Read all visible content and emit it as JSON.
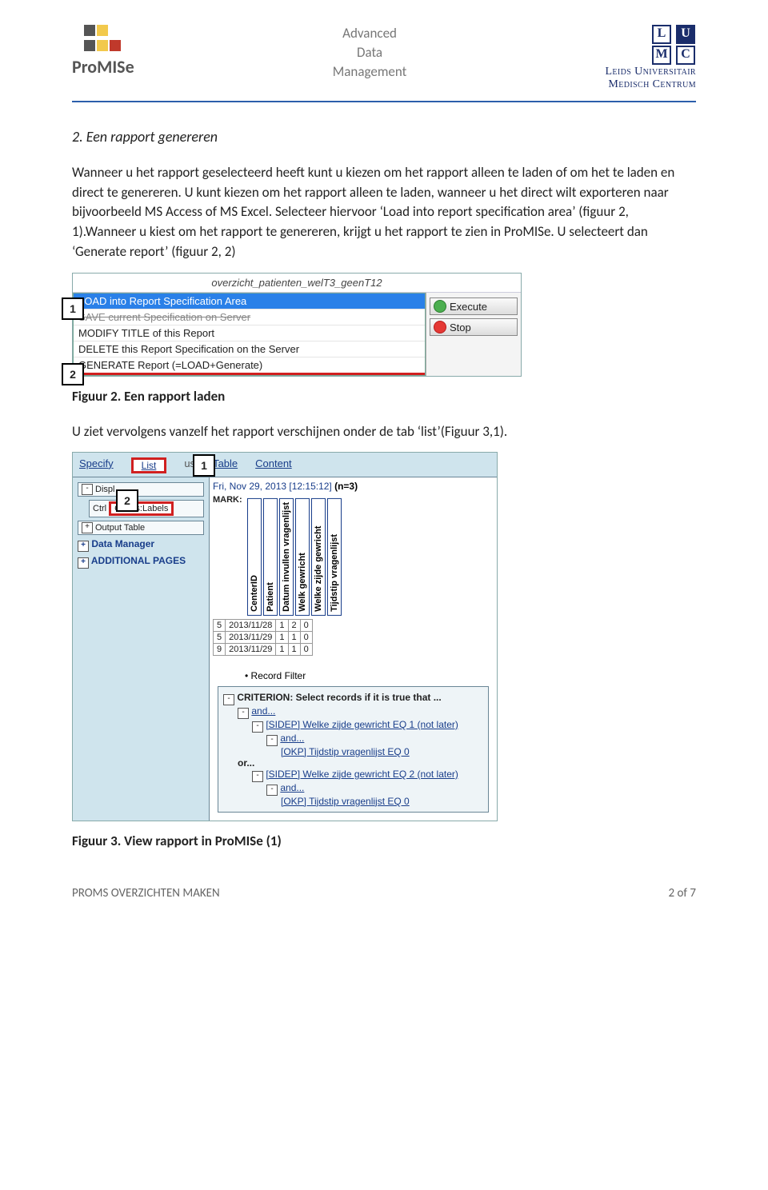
{
  "header": {
    "promise_word": "ProMISe",
    "center_l1": "Advanced",
    "center_l2": "Data",
    "center_l3": "Management",
    "lumc_l": "L",
    "lumc_u": "U",
    "lumc_m": "M",
    "lumc_c": "C",
    "lumc_txt1": "Leids Universitair",
    "lumc_txt2": "Medisch Centrum"
  },
  "section": {
    "num": "2.",
    "title": "Een rapport genereren"
  },
  "para1": "Wanneer u het rapport geselecteerd heeft kunt u kiezen om het rapport alleen te laden of om het te laden en direct te genereren. U kunt kiezen om het rapport alleen te laden, wanneer u het direct wilt exporteren naar bijvoorbeeld MS Access of MS Excel. Selecteer hiervoor ‘Load into report specification area’ (figuur 2, 1).Wanneer u kiest om het rapport te genereren, krijgt u het rapport te zien in ProMISe. U selecteert dan ‘Generate report’ (figuur 2, 2)",
  "fig2": {
    "report_name": "overzicht_patienten_welT3_geenT12",
    "opt1": "LOAD into Report Specification Area",
    "opt2": "SAVE current Specification on Server",
    "opt3": "MODIFY TITLE of this Report",
    "opt4": "DELETE this Report Specification on the Server",
    "opt5": "GENERATE Report (=LOAD+Generate)",
    "btn_exec": "Execute",
    "btn_stop": "Stop",
    "callout1": "1",
    "callout2": "2",
    "caption": "Figuur 2. Een rapport laden"
  },
  "para2": "U ziet vervolgens vanzelf het rapport verschijnen onder de tab ‘list’(Figuur 3,1).",
  "fig3": {
    "tabs": {
      "specify": "Specify",
      "list": "List",
      "us": "us",
      "table": "Table",
      "content": "Content"
    },
    "callout1": "1",
    "callout2": "2",
    "left": {
      "displ": "Displ",
      "ctrl": "Ctrl",
      "codes": "Codes:Labels",
      "output": "Output Table",
      "datamgr": "Data Manager",
      "addpages": "ADDITIONAL PAGES"
    },
    "date": "Fri, Nov 29, 2013 [12:15:12] ",
    "n": "(n=3)",
    "mark": "MARK:",
    "cols": [
      "CenterID",
      "Patient",
      "Datum invullen vragenlijst",
      "Welk gewricht",
      "Welke zijde gewricht",
      "Tijdstip vragenlijst"
    ],
    "rows": [
      [
        "5",
        "2013/11/28",
        "1",
        "2",
        "0"
      ],
      [
        "5",
        "2013/11/29",
        "1",
        "1",
        "0"
      ],
      [
        "9",
        "2013/11/29",
        "1",
        "1",
        "0"
      ]
    ],
    "record_filter": "Record Filter",
    "crit_header": "CRITERION: Select records if it is true that ...",
    "and": "and...",
    "line1": "[SIDEP] Welke zijde gewricht EQ 1 (not later)",
    "line_okp": "[OKP] Tijdstip vragenlijst EQ 0",
    "or": "or...",
    "line2": "[SIDEP] Welke zijde gewricht EQ 2 (not later)",
    "caption": "Figuur 3. View rapport in ProMISe (1)"
  },
  "footer": {
    "left": "PROMS OVERZICHTEN MAKEN",
    "right": "2 of  7"
  }
}
